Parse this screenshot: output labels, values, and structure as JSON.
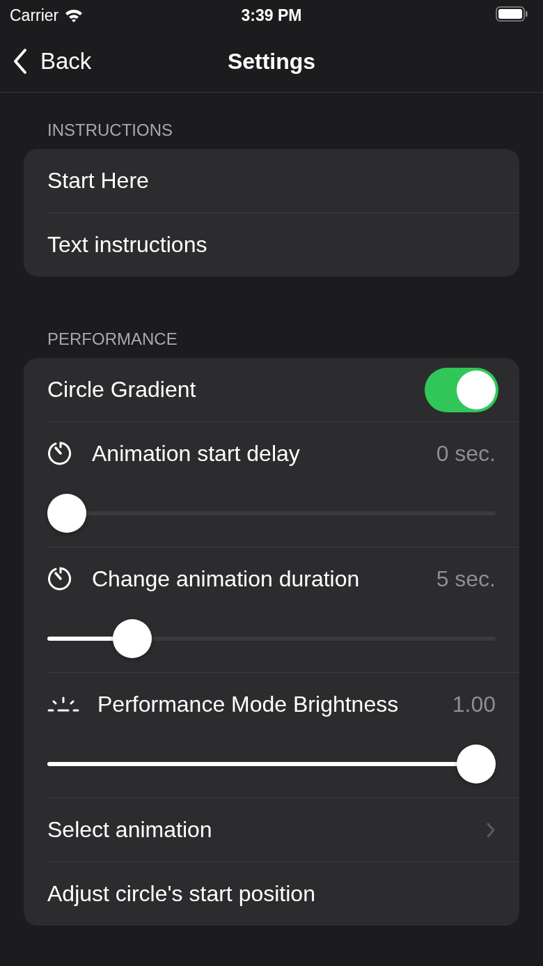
{
  "status_bar": {
    "carrier": "Carrier",
    "time": "3:39 PM"
  },
  "nav": {
    "back": "Back",
    "title": "Settings"
  },
  "sections": [
    {
      "header": "INSTRUCTIONS",
      "rows": [
        {
          "kind": "plain",
          "label": "Start Here"
        },
        {
          "kind": "plain",
          "label": "Text instructions"
        }
      ]
    },
    {
      "header": "PERFORMANCE",
      "rows": [
        {
          "kind": "toggle",
          "label": "Circle Gradient",
          "on": true
        },
        {
          "kind": "timer_slider",
          "label": "Animation start delay",
          "reading": "0 sec.",
          "level": 0
        },
        {
          "kind": "timer_slider",
          "label": "Change animation duration",
          "reading": "5 sec.",
          "level": 0.16
        },
        {
          "kind": "brightness_slider",
          "label": "Performance Mode Brightness",
          "reading": "1.00",
          "level": 1
        },
        {
          "kind": "link",
          "label": "Select animation"
        },
        {
          "kind": "plain",
          "label": "Adjust circle's start position"
        }
      ]
    }
  ]
}
